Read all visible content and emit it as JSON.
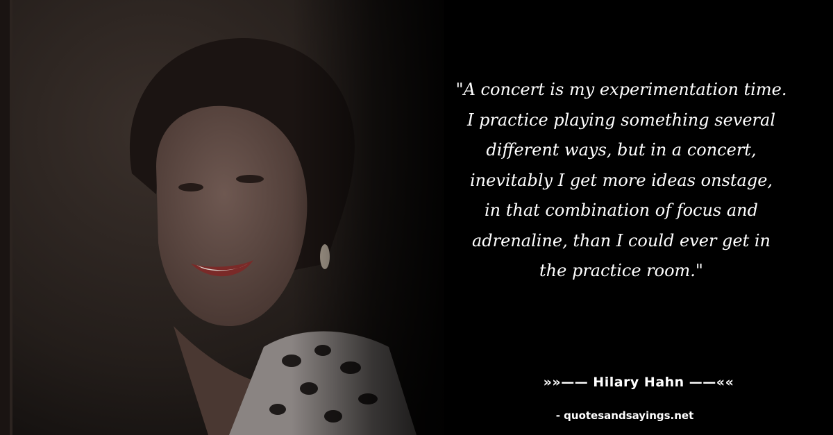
{
  "quote": {
    "lines": [
      "\"A concert is my experimentation time.",
      "I practice playing something several",
      "different ways, but in a concert,",
      "inevitably I get more ideas onstage,",
      "in that combination of focus and",
      "adrenaline, than I could ever get in",
      "the practice room.\""
    ]
  },
  "author": "»»—— Hilary Hahn ——««",
  "source": "- quotesandsayings.net",
  "colors": {
    "background": "#000000",
    "text": "#ffffff"
  }
}
